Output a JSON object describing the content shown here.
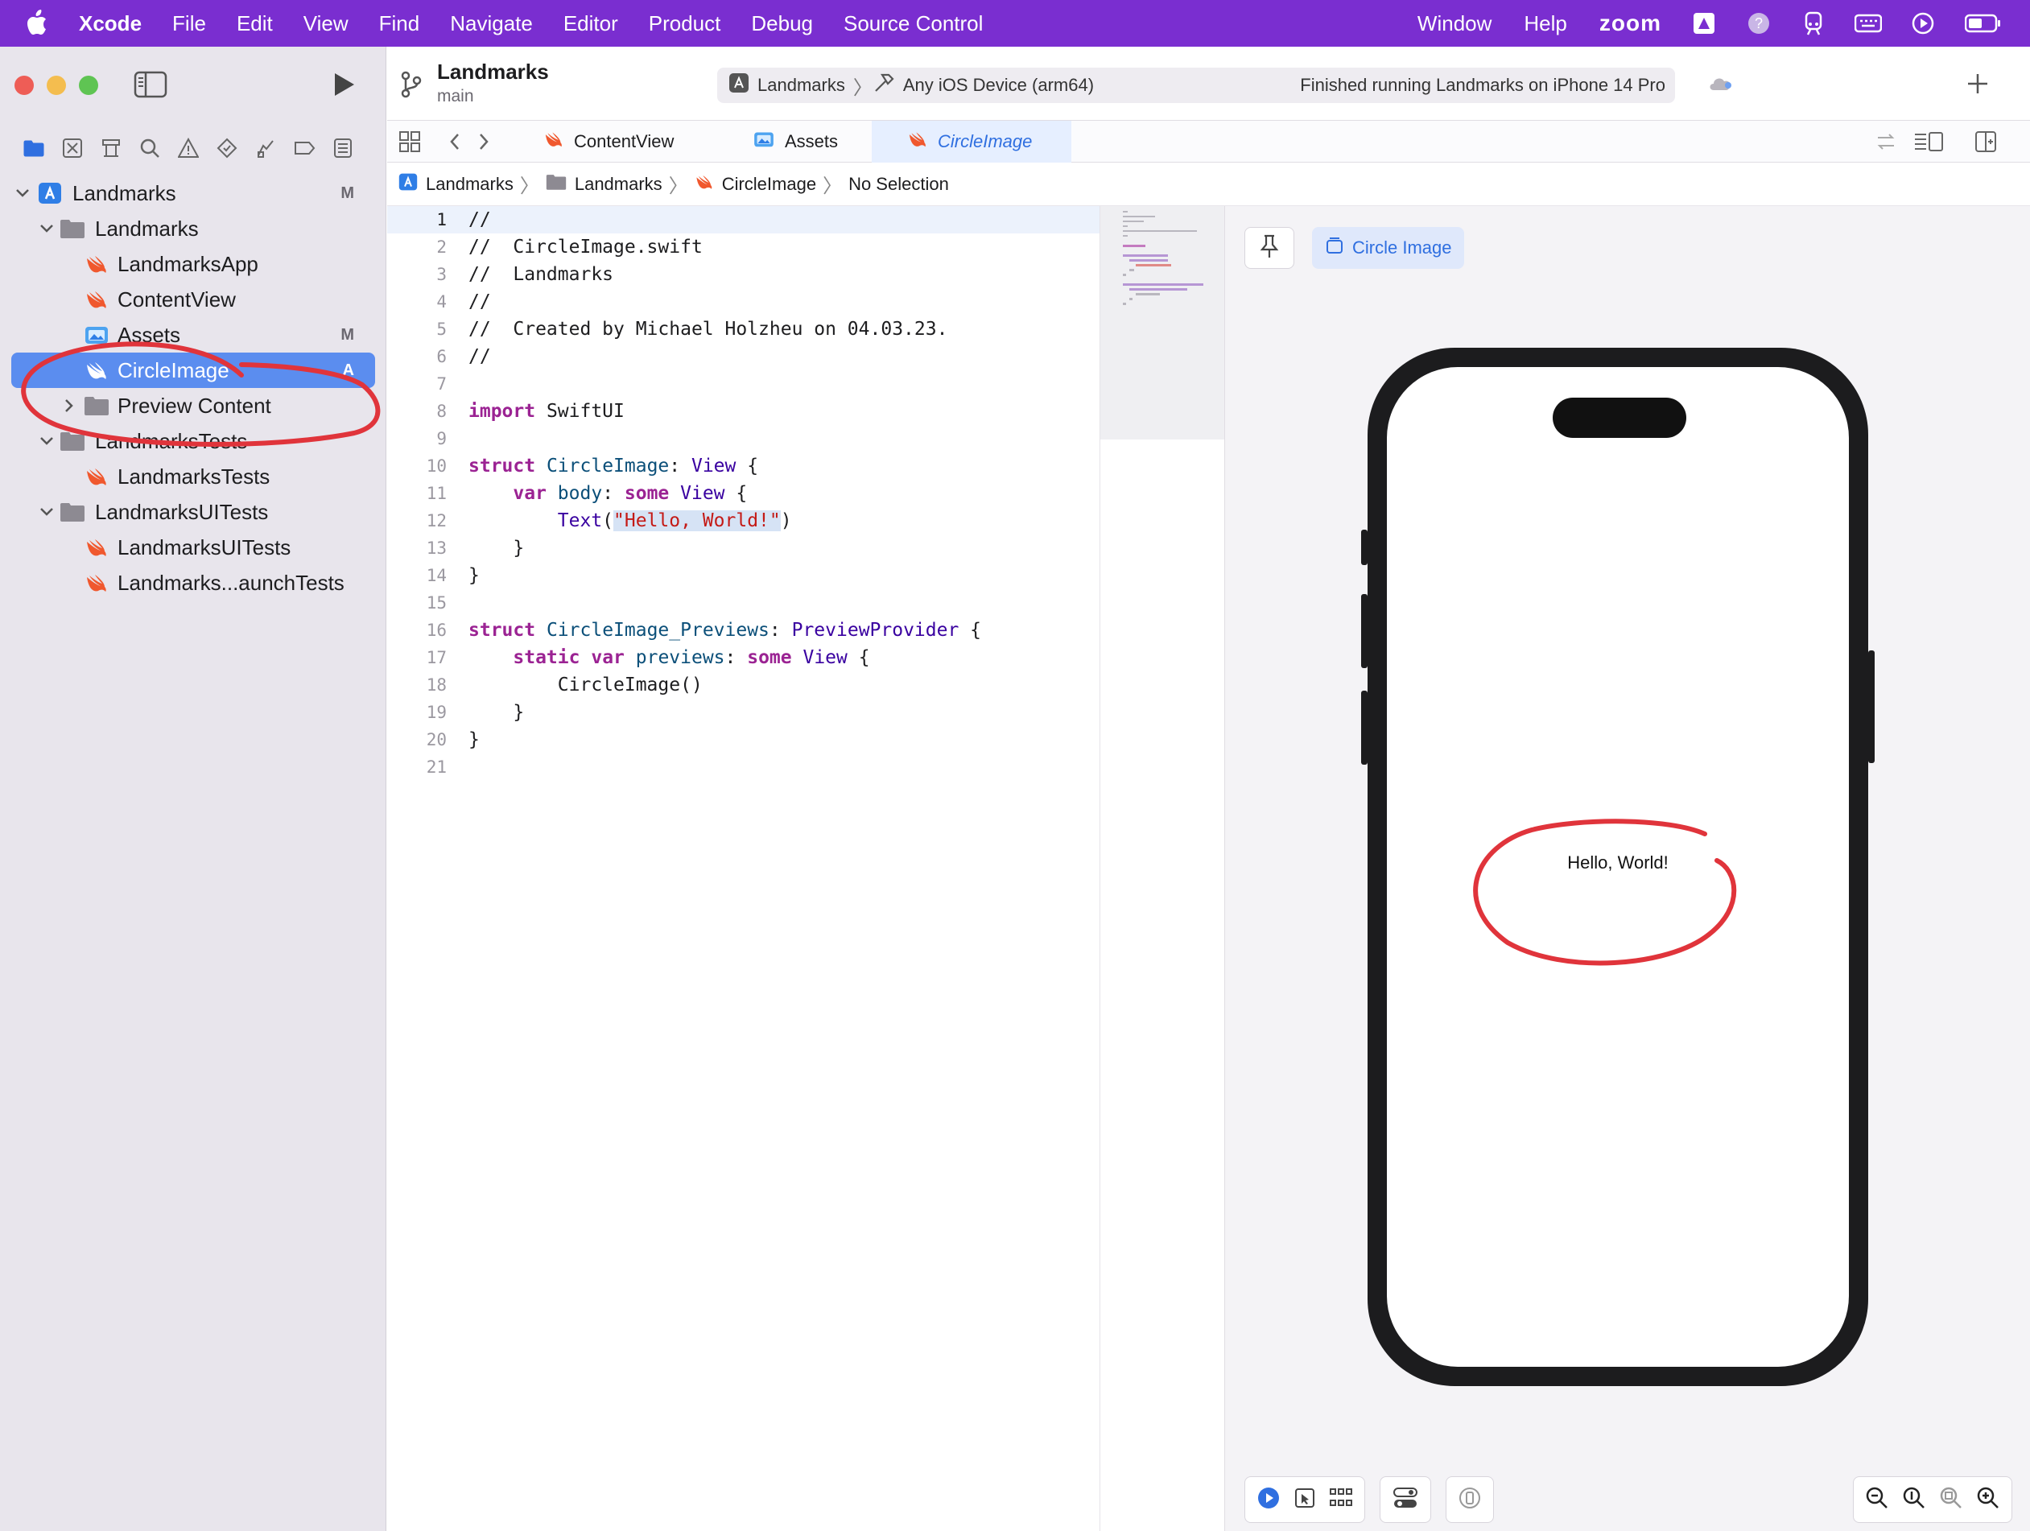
{
  "menubar": {
    "app": "Xcode",
    "items": [
      "File",
      "Edit",
      "View",
      "Find",
      "Navigate",
      "Editor",
      "Product",
      "Debug",
      "Source Control"
    ],
    "right_items": [
      "Window",
      "Help"
    ],
    "zoom": "zoom",
    "tray_icons": [
      "notch-app-icon",
      "help-badge-icon",
      "train-icon",
      "keyboard-icon",
      "play-circle-icon",
      "battery-icon"
    ]
  },
  "toolbar": {
    "scheme_title": "Landmarks",
    "branch": "main",
    "activity": {
      "project": "Landmarks",
      "device": "Any iOS Device (arm64)",
      "status": "Finished running Landmarks on iPhone 14 Pro"
    }
  },
  "tabs": [
    {
      "label": "ContentView",
      "icon": "swift-icon"
    },
    {
      "label": "Assets",
      "icon": "assets-icon"
    },
    {
      "label": "CircleImage",
      "icon": "swift-icon",
      "active": true
    }
  ],
  "jumpbar": {
    "crumbs": [
      "Landmarks",
      "Landmarks",
      "CircleImage",
      "No Selection"
    ]
  },
  "navigator": {
    "items": [
      {
        "label": "Landmarks",
        "badge": "M"
      },
      {
        "label": "Landmarks",
        "badge": ""
      },
      {
        "label": "LandmarksApp",
        "badge": ""
      },
      {
        "label": "ContentView",
        "badge": ""
      },
      {
        "label": "Assets",
        "badge": "M"
      },
      {
        "label": "CircleImage",
        "badge": "A"
      },
      {
        "label": "Preview Content",
        "badge": ""
      },
      {
        "label": "LandmarksTests",
        "badge": ""
      },
      {
        "label": "LandmarksTests",
        "badge": ""
      },
      {
        "label": "LandmarksUITests",
        "badge": ""
      },
      {
        "label": "LandmarksUITests",
        "badge": ""
      },
      {
        "label": "Landmarks...aunchTests",
        "badge": ""
      }
    ]
  },
  "editor": {
    "lines": [
      "1",
      "2",
      "3",
      "4",
      "5",
      "6",
      "7",
      "8",
      "9",
      "10",
      "11",
      "12",
      "13",
      "14",
      "15",
      "16",
      "17",
      "18",
      "19",
      "20",
      "21"
    ],
    "comment_file": "//  CircleImage.swift",
    "comment_project": "//  Landmarks",
    "comment_created": "//  Created by Michael Holzheu on 04.03.23.",
    "string_literal": "\"Hello, World!\""
  },
  "preview": {
    "chip_label": "Circle Image",
    "text": "Hello, World!"
  },
  "colors": {
    "menubar": "#7a2ed0",
    "selection": "#5b8def",
    "accent": "#2f6fe0",
    "annotation": "#e0343b"
  }
}
